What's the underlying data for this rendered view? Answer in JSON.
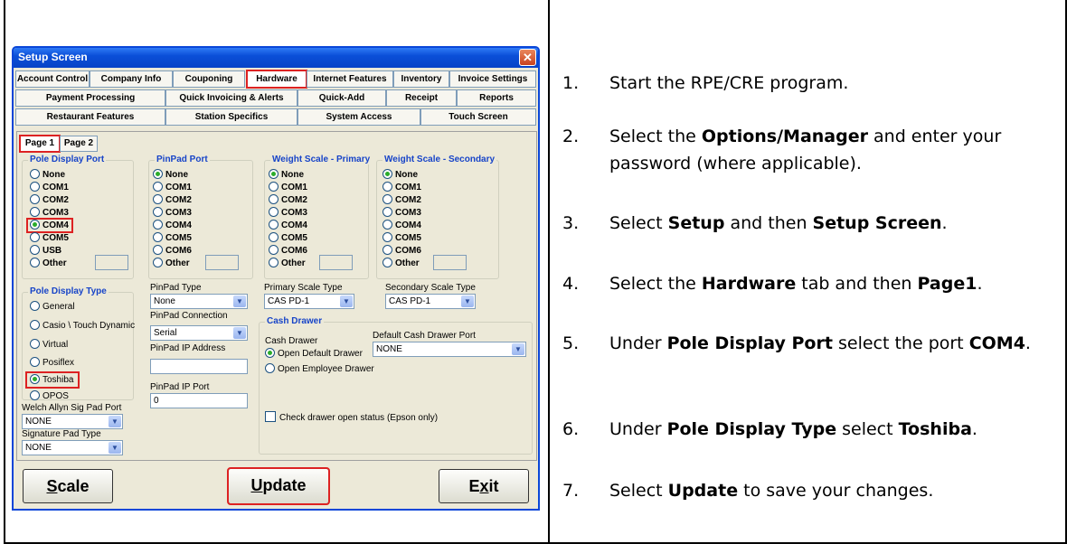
{
  "window": {
    "title": "Setup Screen",
    "close_glyph": "✕"
  },
  "tabs_row1": [
    "Account Control",
    "Company Info",
    "Couponing",
    "Hardware",
    "Internet Features",
    "Inventory",
    "Invoice Settings"
  ],
  "tabs_row2": [
    "Payment Processing",
    "Quick Invoicing & Alerts",
    "Quick-Add",
    "Receipt",
    "Reports"
  ],
  "tabs_row3": [
    "Restaurant Features",
    "Station Specifics",
    "System Access",
    "Touch Screen"
  ],
  "active_tab": "Hardware",
  "subtabs": [
    "Page 1",
    "Page 2"
  ],
  "pole_display_port": {
    "legend": "Pole Display Port",
    "options": [
      "None",
      "COM1",
      "COM2",
      "COM3",
      "COM4",
      "COM5",
      "USB",
      "Other"
    ],
    "selected": "COM4"
  },
  "pinpad_port": {
    "legend": "PinPad Port",
    "options": [
      "None",
      "COM1",
      "COM2",
      "COM3",
      "COM4",
      "COM5",
      "COM6",
      "Other"
    ],
    "selected": "None"
  },
  "weight_primary": {
    "legend": "Weight Scale - Primary",
    "options": [
      "None",
      "COM1",
      "COM2",
      "COM3",
      "COM4",
      "COM5",
      "COM6",
      "Other"
    ],
    "selected": "None"
  },
  "weight_secondary": {
    "legend": "Weight Scale - Secondary",
    "options": [
      "None",
      "COM1",
      "COM2",
      "COM3",
      "COM4",
      "COM5",
      "COM6",
      "Other"
    ],
    "selected": "None"
  },
  "pole_display_type": {
    "legend": "Pole Display Type",
    "options": [
      "General",
      "Casio \\ Touch Dynamic",
      "Virtual",
      "Posiflex",
      "Toshiba",
      "OPOS"
    ],
    "selected": "Toshiba"
  },
  "pinpad": {
    "type_label": "PinPad Type",
    "type_value": "None",
    "connection_label": "PinPad Connection",
    "connection_value": "Serial",
    "ip_label": "PinPad IP Address",
    "ip_value": "",
    "port_label": "PinPad IP Port",
    "port_value": "0"
  },
  "scales": {
    "primary_label": "Primary Scale Type",
    "primary_value": "CAS PD-1",
    "secondary_label": "Secondary Scale Type",
    "secondary_value": "CAS PD-1"
  },
  "cash_drawer": {
    "legend": "Cash Drawer",
    "label": "Cash Drawer",
    "options": [
      "Open Default Drawer",
      "Open Employee Drawer"
    ],
    "selected": "Open Default Drawer",
    "default_port_label": "Default Cash Drawer Port",
    "default_port_value": "NONE",
    "check_label": "Check drawer open status (Epson only)"
  },
  "welch": {
    "label": "Welch Allyn Sig Pad Port",
    "value": "NONE",
    "sig_label": "Signature Pad Type",
    "sig_value": "NONE"
  },
  "buttons": {
    "scale_first": "S",
    "scale_rest": "cale",
    "update_first": "U",
    "update_rest": "pdate",
    "exit_first": "E",
    "exit_mid": "x",
    "exit_rest": "it"
  },
  "steps": [
    {
      "num": "1.",
      "parts": [
        "Start the RPE/CRE program."
      ]
    },
    {
      "num": "2.",
      "pre": "Select the ",
      "b1": "Options/Manager",
      "post": " and enter your password (where applicable)."
    },
    {
      "num": "3.",
      "pre": "Select ",
      "b1": "Setup",
      "mid": " and then ",
      "b2": "Setup Screen",
      "post": "."
    },
    {
      "num": "4.",
      "pre": "Select the ",
      "b1": "Hardware",
      "mid": " tab and then ",
      "b2": "Page1",
      "post": "."
    },
    {
      "num": "5.",
      "pre": "Under ",
      "b1": "Pole Display Port",
      "mid": " select the port ",
      "b2": "COM4",
      "post": "."
    },
    {
      "num": "6.",
      "pre": "Under ",
      "b1": "Pole Display Type",
      "mid": " select ",
      "b2": "Toshiba",
      "post": "."
    },
    {
      "num": "7.",
      "pre": "Select ",
      "b1": "Update",
      "post": " to save your changes."
    }
  ],
  "colors": {
    "titlebar": "#0a4fd8",
    "highlight": "#dd2222",
    "legend_text": "#1744c8",
    "radio_on": "#2bac2b"
  }
}
